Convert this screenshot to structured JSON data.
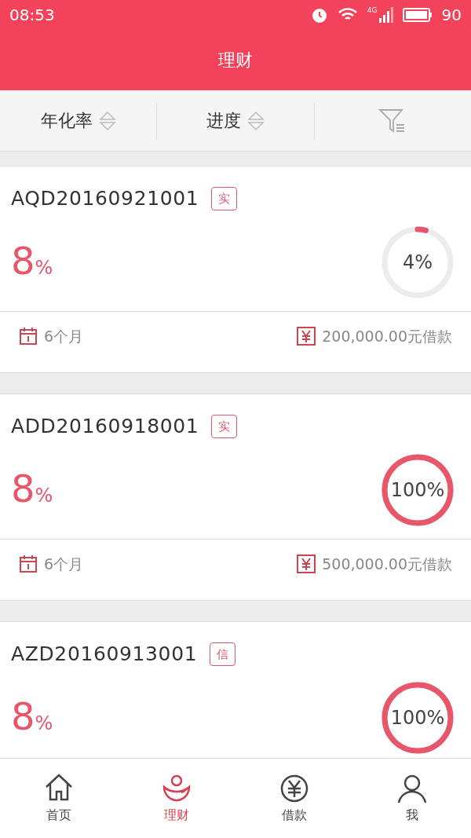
{
  "status_bar": {
    "time": "08:53",
    "battery": "90",
    "network": "4G"
  },
  "header": {
    "title": "理财"
  },
  "sort_bar": [
    {
      "kind": "sort",
      "label": "年化率"
    },
    {
      "kind": "sort",
      "label": "进度"
    },
    {
      "kind": "filter"
    }
  ],
  "products": [
    {
      "code": "AQD20160921001",
      "tag": "实",
      "rate": "8",
      "rate_unit": "%",
      "progress": "4%",
      "term": "6个月",
      "amount": "200,000.00元借款"
    },
    {
      "code": "ADD20160918001",
      "tag": "实",
      "rate": "8",
      "rate_unit": "%",
      "progress": "100%",
      "term": "6个月",
      "amount": "500,000.00元借款"
    },
    {
      "code": "AZD20160913001",
      "tag": "信",
      "rate": "8",
      "rate_unit": "%",
      "progress": "100%"
    }
  ],
  "nav": [
    {
      "kind": "home",
      "label": "首页",
      "selected": false
    },
    {
      "kind": "invest",
      "label": "理财",
      "selected": true
    },
    {
      "kind": "loan",
      "label": "借款",
      "selected": false
    },
    {
      "kind": "me",
      "label": "我",
      "selected": false
    }
  ]
}
